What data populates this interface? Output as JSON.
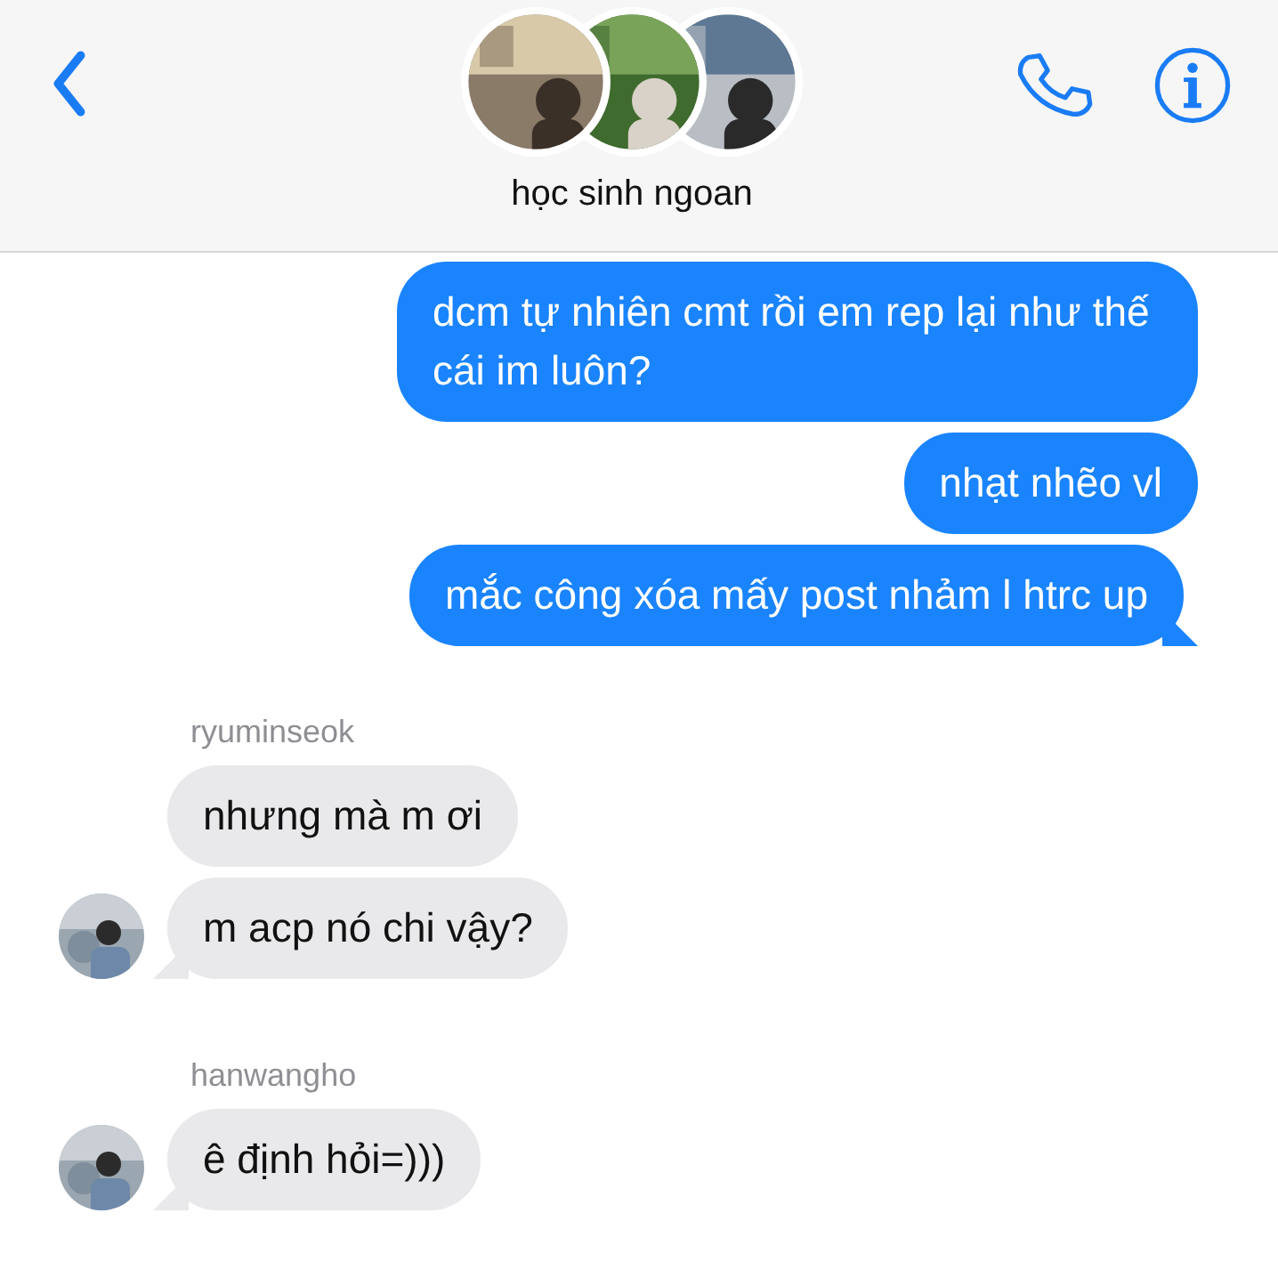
{
  "header": {
    "title": "học sinh ngoan"
  },
  "messages": [
    {
      "kind": "sent",
      "text": "dcm tự nhiên cmt rồi em rep lại như thế cái im luôn?",
      "tail": false
    },
    {
      "kind": "sent",
      "text": "nhạt nhẽo vl",
      "tail": false
    },
    {
      "kind": "sent",
      "text": "mắc công xóa mấy post nhảm l htrc up",
      "tail": true
    },
    {
      "kind": "name",
      "text": "ryuminseok"
    },
    {
      "kind": "received",
      "text": "nhưng mà m ơi",
      "tail": false,
      "avatar": false
    },
    {
      "kind": "received",
      "text": "m acp nó chi vậy?",
      "tail": true,
      "avatar": true
    },
    {
      "kind": "name",
      "text": "hanwangho"
    },
    {
      "kind": "received",
      "text": "ê định hỏi=)))",
      "tail": true,
      "avatar": true
    }
  ]
}
